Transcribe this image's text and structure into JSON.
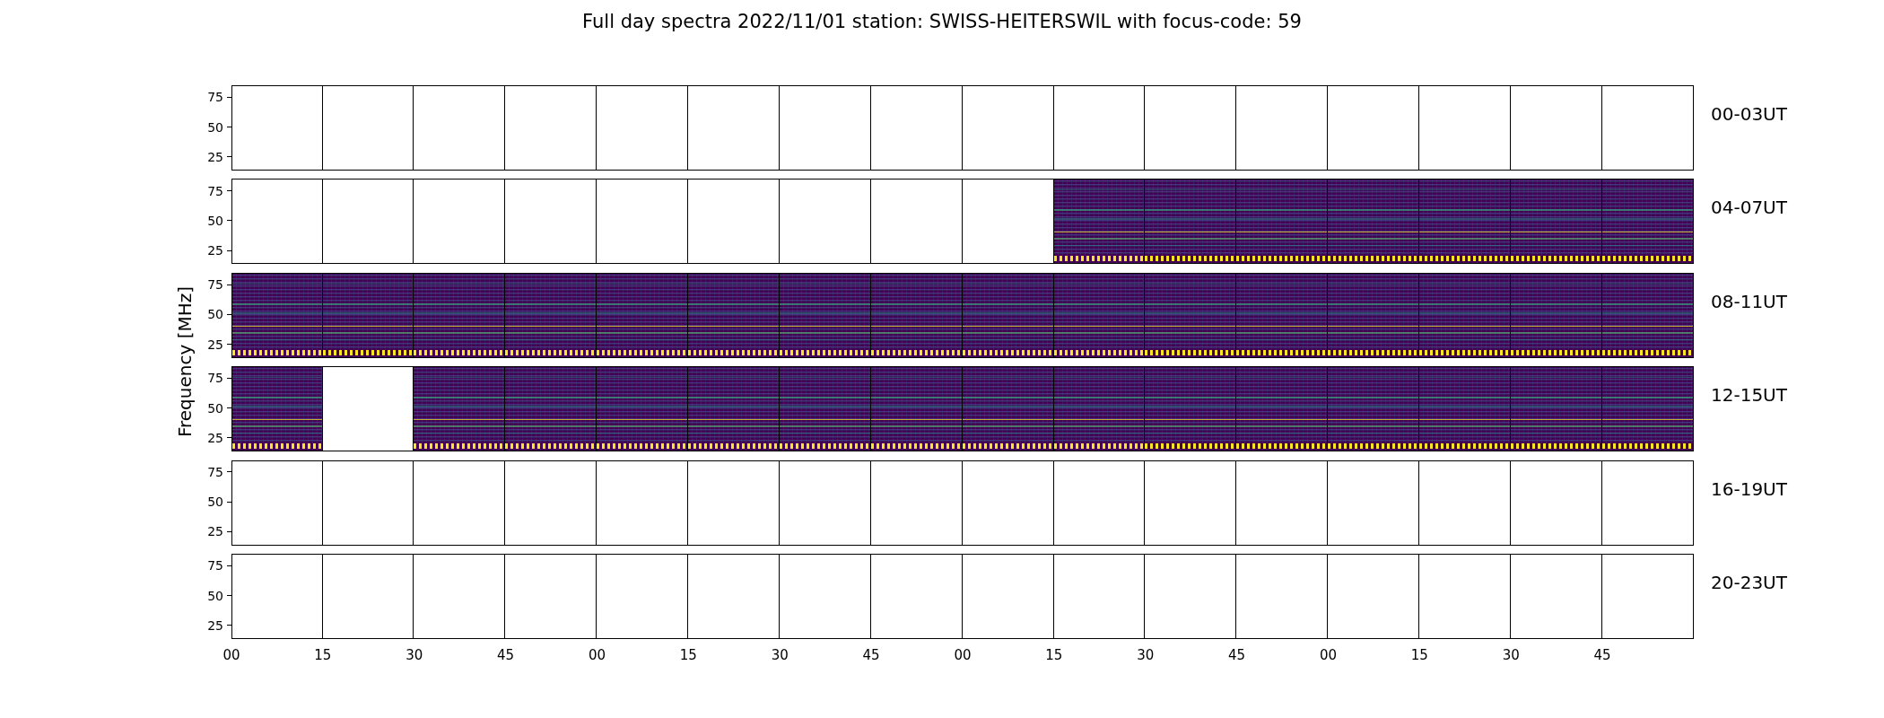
{
  "title": "Full day spectra 2022/11/01 station: SWISS-HEITERSWIL with focus-code: 59",
  "y_axis_label": "Frequency [MHz]",
  "rows": [
    {
      "label": "00-03UT",
      "y_ticks": [
        "75",
        "50",
        "25"
      ],
      "panels": [
        {
          "has_data": false
        },
        {
          "has_data": false
        },
        {
          "has_data": false
        },
        {
          "has_data": false
        },
        {
          "has_data": false
        },
        {
          "has_data": false
        },
        {
          "has_data": false
        },
        {
          "has_data": false
        },
        {
          "has_data": false
        },
        {
          "has_data": false
        },
        {
          "has_data": false
        },
        {
          "has_data": false
        },
        {
          "has_data": false
        },
        {
          "has_data": false
        },
        {
          "has_data": false
        },
        {
          "has_data": false
        }
      ]
    },
    {
      "label": "04-07UT",
      "y_ticks": [
        "75",
        "50",
        "25"
      ],
      "panels": [
        {
          "has_data": false
        },
        {
          "has_data": false
        },
        {
          "has_data": false
        },
        {
          "has_data": false
        },
        {
          "has_data": false
        },
        {
          "has_data": false
        },
        {
          "has_data": false
        },
        {
          "has_data": false
        },
        {
          "has_data": false
        },
        {
          "has_data": true
        },
        {
          "has_data": true
        },
        {
          "has_data": true
        },
        {
          "has_data": true
        },
        {
          "has_data": true
        },
        {
          "has_data": true
        },
        {
          "has_data": true
        }
      ]
    },
    {
      "label": "08-11UT",
      "y_ticks": [
        "75",
        "50",
        "25"
      ],
      "panels": [
        {
          "has_data": true
        },
        {
          "has_data": true
        },
        {
          "has_data": true
        },
        {
          "has_data": true
        },
        {
          "has_data": true
        },
        {
          "has_data": true
        },
        {
          "has_data": true
        },
        {
          "has_data": true
        },
        {
          "has_data": true
        },
        {
          "has_data": true
        },
        {
          "has_data": true
        },
        {
          "has_data": true
        },
        {
          "has_data": true
        },
        {
          "has_data": true
        },
        {
          "has_data": true
        },
        {
          "has_data": true
        }
      ]
    },
    {
      "label": "12-15UT",
      "y_ticks": [
        "75",
        "50",
        "25"
      ],
      "panels": [
        {
          "has_data": true
        },
        {
          "has_data": false
        },
        {
          "has_data": true
        },
        {
          "has_data": true
        },
        {
          "has_data": true
        },
        {
          "has_data": true
        },
        {
          "has_data": true
        },
        {
          "has_data": true
        },
        {
          "has_data": true
        },
        {
          "has_data": true
        },
        {
          "has_data": true
        },
        {
          "has_data": true
        },
        {
          "has_data": true
        },
        {
          "has_data": true
        },
        {
          "has_data": true
        },
        {
          "has_data": true
        }
      ]
    },
    {
      "label": "16-19UT",
      "y_ticks": [
        "75",
        "50",
        "25"
      ],
      "panels": [
        {
          "has_data": false
        },
        {
          "has_data": false
        },
        {
          "has_data": false
        },
        {
          "has_data": false
        },
        {
          "has_data": false
        },
        {
          "has_data": false
        },
        {
          "has_data": false
        },
        {
          "has_data": false
        },
        {
          "has_data": false
        },
        {
          "has_data": false
        },
        {
          "has_data": false
        },
        {
          "has_data": false
        },
        {
          "has_data": false
        },
        {
          "has_data": false
        },
        {
          "has_data": false
        },
        {
          "has_data": false
        }
      ]
    },
    {
      "label": "20-23UT",
      "y_ticks": [
        "75",
        "50",
        "25"
      ],
      "panels": [
        {
          "has_data": false
        },
        {
          "has_data": false
        },
        {
          "has_data": false
        },
        {
          "has_data": false
        },
        {
          "has_data": false
        },
        {
          "has_data": false
        },
        {
          "has_data": false
        },
        {
          "has_data": false
        },
        {
          "has_data": false
        },
        {
          "has_data": false
        },
        {
          "has_data": false
        },
        {
          "has_data": false
        },
        {
          "has_data": false
        },
        {
          "has_data": false
        },
        {
          "has_data": false
        },
        {
          "has_data": false
        }
      ]
    }
  ],
  "x_ticks": [
    "00",
    "15",
    "30",
    "45",
    "00",
    "15",
    "30",
    "45",
    "00",
    "15",
    "30",
    "45",
    "00",
    "15",
    "30",
    "45"
  ]
}
